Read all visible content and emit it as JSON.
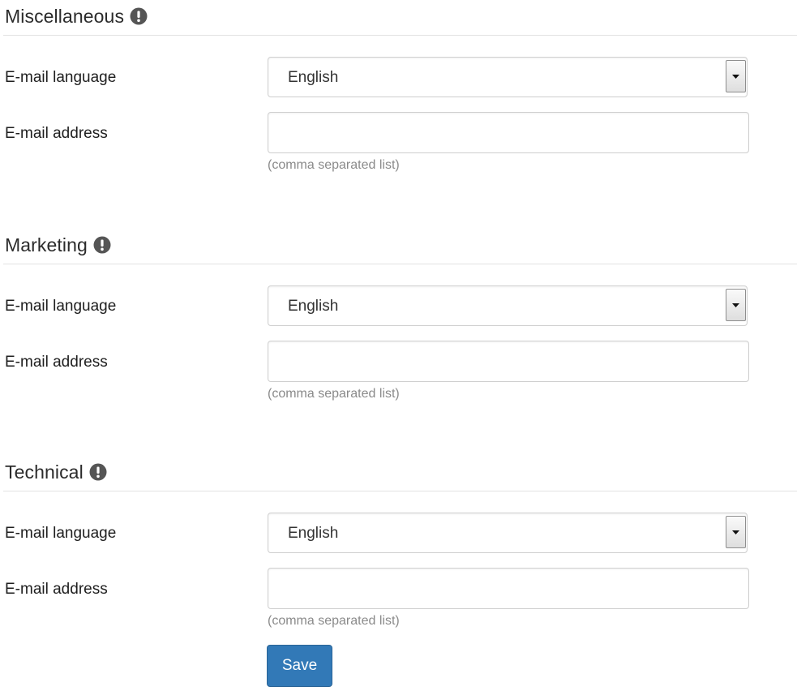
{
  "sections": [
    {
      "title": "Miscellaneous",
      "language_label": "E-mail language",
      "language_value": "English",
      "address_label": "E-mail address",
      "address_value": "",
      "address_help": "(comma separated list)"
    },
    {
      "title": "Marketing",
      "language_label": "E-mail language",
      "language_value": "English",
      "address_label": "E-mail address",
      "address_value": "",
      "address_help": "(comma separated list)"
    },
    {
      "title": "Technical",
      "language_label": "E-mail language",
      "language_value": "English",
      "address_label": "E-mail address",
      "address_value": "",
      "address_help": "(comma separated list)"
    }
  ],
  "icons": {
    "section_info": "exclamation-circle-icon",
    "select_arrow": "triangle-down-icon"
  },
  "actions": {
    "save_label": "Save"
  },
  "colors": {
    "primary_button": "#3279b7",
    "info_icon": "#555555",
    "help_text": "#8a8a8a"
  }
}
